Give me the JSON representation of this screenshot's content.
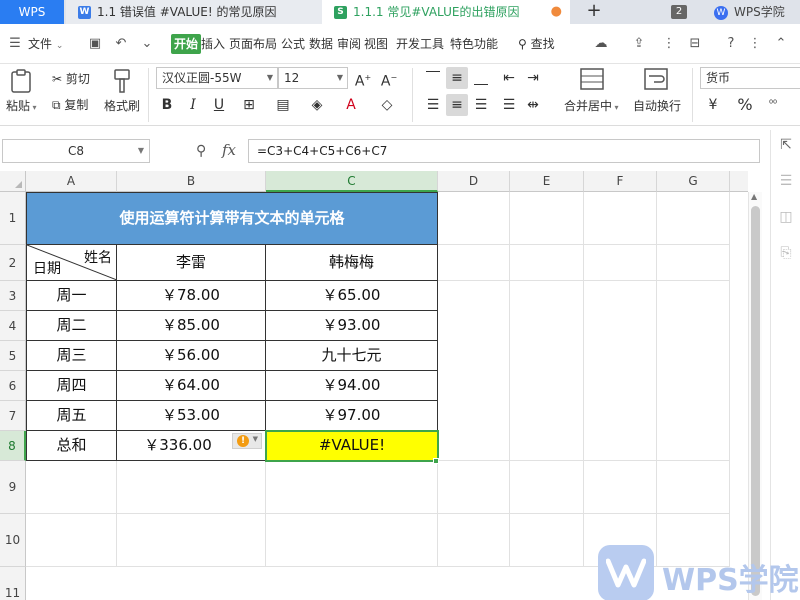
{
  "tabs": {
    "home": "WPS",
    "doc1": "1.1 错误值 #VALUE! 的常见原因",
    "doc2": "1.1.1 常见#VALUE的出错原因",
    "doc_icon_w": "W",
    "doc_icon_s": "S",
    "window_count": "2",
    "academy": "WPS学院"
  },
  "menu": {
    "file": "文件",
    "items": [
      "开始",
      "插入",
      "页面布局",
      "公式",
      "数据",
      "审阅",
      "视图",
      "开发工具",
      "特色功能"
    ],
    "search": "查找"
  },
  "ribbon": {
    "cut": "剪切",
    "copy": "复制",
    "paste": "粘贴",
    "format_painter": "格式刷",
    "font_name": "汉仪正圆-55W",
    "font_size": "12",
    "bold": "B",
    "italic": "I",
    "underline": "U",
    "merge_center": "合并居中",
    "wrap_text": "自动换行",
    "number_format": "货币",
    "percent": "%"
  },
  "formula_bar": {
    "name_box": "C8",
    "fx": "fx",
    "formula": "=C3+C4+C5+C6+C7"
  },
  "sheet": {
    "columns": [
      "A",
      "B",
      "C",
      "D",
      "E",
      "F",
      "G"
    ],
    "rows": [
      "1",
      "2",
      "3",
      "4",
      "5",
      "6",
      "7",
      "8",
      "9",
      "10",
      "11"
    ],
    "selected_cell": "C8",
    "table": {
      "title": "使用运算符计算带有文本的单元格",
      "header_name_label": "姓名",
      "header_date_label": "日期",
      "person_b": "李雷",
      "person_c": "韩梅梅",
      "days": [
        "周一",
        "周二",
        "周三",
        "周四",
        "周五"
      ],
      "col_b_values": [
        "￥78.00",
        "￥85.00",
        "￥56.00",
        "￥64.00",
        "￥53.00"
      ],
      "col_c_values": [
        "￥65.00",
        "￥93.00",
        "九十七元",
        "￥94.00",
        "￥97.00"
      ],
      "total_label": "总和",
      "total_b": "￥336.00",
      "total_c": "#VALUE!"
    },
    "colors": {
      "title_fill": "#5b9bd5",
      "error_fill": "#ffff00",
      "selection": "#3ea44b"
    }
  },
  "watermark": {
    "text": "WPS学院"
  }
}
